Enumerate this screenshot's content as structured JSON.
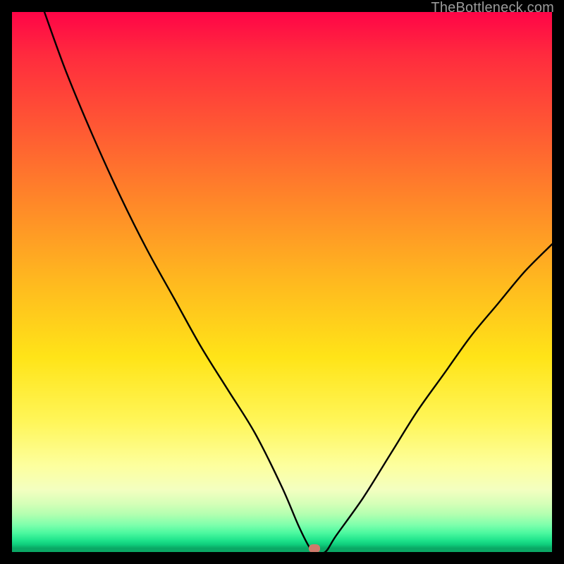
{
  "watermark": "TheBottleneck.com",
  "marker": {
    "x_pct": 56.0,
    "y_pct": 99.3
  },
  "chart_data": {
    "type": "line",
    "title": "",
    "xlabel": "",
    "ylabel": "",
    "xlim": [
      0,
      100
    ],
    "ylim": [
      0,
      100
    ],
    "grid": false,
    "series": [
      {
        "name": "bottleneck-curve",
        "comment": "V-shaped curve; y ≈ 0 is ideal (green), y ≈ 100 is worst (red). Estimated from pixel positions.",
        "x": [
          6,
          10,
          15,
          20,
          25,
          30,
          35,
          40,
          45,
          50,
          53,
          55,
          56,
          58,
          60,
          65,
          70,
          75,
          80,
          85,
          90,
          95,
          100
        ],
        "y": [
          100,
          89,
          77,
          66,
          56,
          47,
          38,
          30,
          22,
          12,
          5,
          1,
          0,
          0,
          3,
          10,
          18,
          26,
          33,
          40,
          46,
          52,
          57
        ]
      }
    ],
    "background_gradient": {
      "orientation": "vertical",
      "stops": [
        {
          "pct": 0,
          "color": "#ff0447"
        },
        {
          "pct": 50,
          "color": "#ffb91f"
        },
        {
          "pct": 84,
          "color": "#fdff9e"
        },
        {
          "pct": 97,
          "color": "#20e48c"
        },
        {
          "pct": 100,
          "color": "#0aa865"
        }
      ]
    },
    "marker": {
      "x": 56,
      "y": 0.7,
      "color": "#cf7a6b"
    }
  }
}
